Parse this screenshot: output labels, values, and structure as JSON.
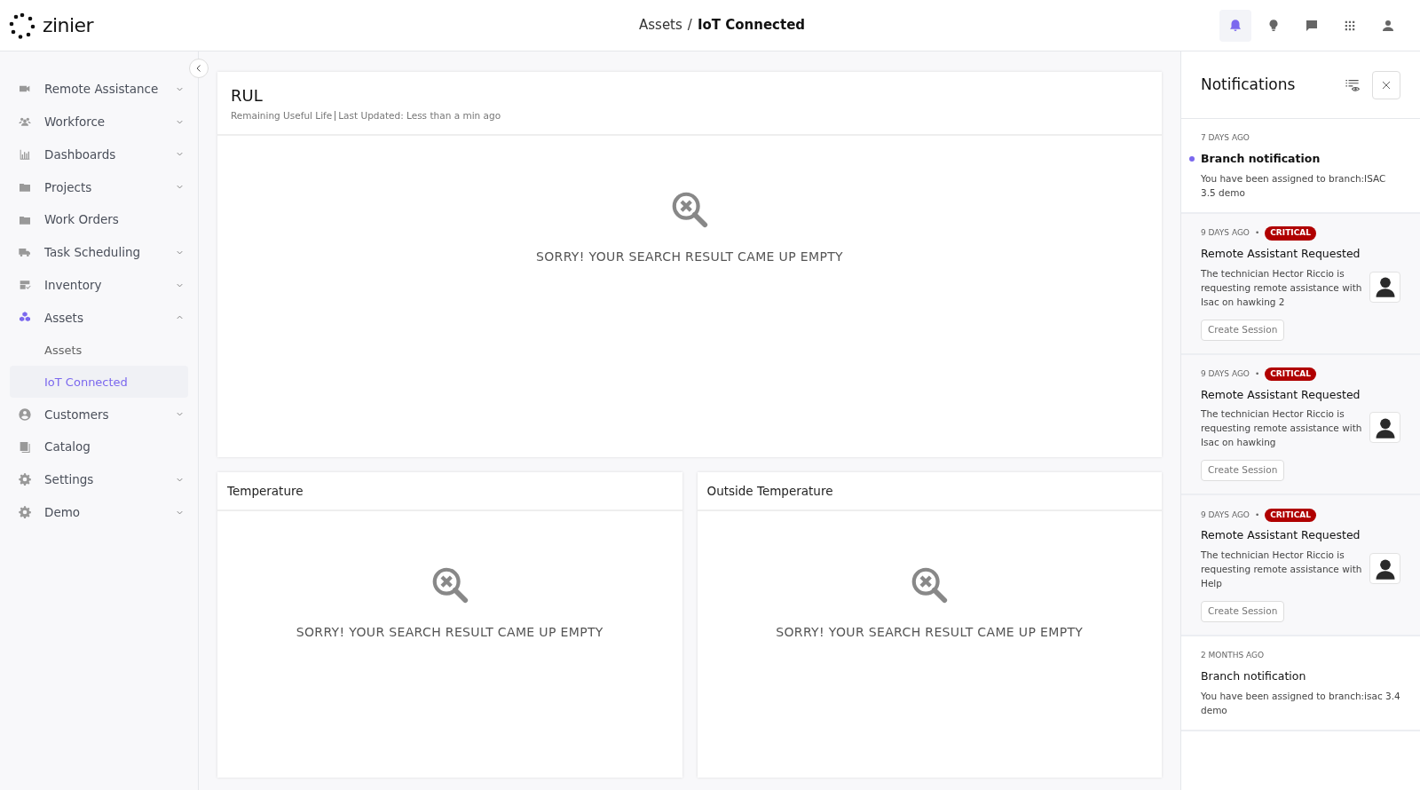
{
  "header": {
    "logo": "zinier",
    "breadcrumb": [
      "Assets",
      "IoT Connected"
    ],
    "breadcrumb_separator": "/",
    "icons": [
      {
        "kind": "bell",
        "selected": true
      },
      {
        "kind": "bulb",
        "selected": false
      },
      {
        "kind": "chat",
        "selected": false
      },
      {
        "kind": "apps",
        "selected": false
      },
      {
        "kind": "user",
        "selected": false
      }
    ]
  },
  "sidebar": {
    "items": [
      {
        "label": "Remote Assistance",
        "kind": "video",
        "expanded": false
      },
      {
        "label": "Workforce",
        "kind": "people",
        "expanded": false
      },
      {
        "label": "Dashboards",
        "kind": "chart",
        "expanded": false
      },
      {
        "label": "Projects",
        "kind": "card",
        "expanded": false
      },
      {
        "label": "Work Orders",
        "kind": "card"
      },
      {
        "label": "Task Scheduling",
        "kind": "truck",
        "expanded": false
      },
      {
        "label": "Inventory",
        "kind": "box",
        "expanded": false
      },
      {
        "label": "Assets",
        "kind": "cubes",
        "expanded": true,
        "children": [
          {
            "label": "Assets",
            "selected": false
          },
          {
            "label": "IoT Connected",
            "selected": true
          }
        ]
      },
      {
        "label": "Customers",
        "kind": "person",
        "expanded": false
      },
      {
        "label": "Catalog",
        "kind": "book"
      },
      {
        "label": "Settings",
        "kind": "gear",
        "expanded": false
      },
      {
        "label": "Demo",
        "kind": "gear",
        "expanded": false
      }
    ]
  },
  "rul_card": {
    "title": "RUL",
    "subtitle": "Remaining Useful Life",
    "updated": "Last Updated: Less than a min ago",
    "empty_message": "SORRY! YOUR SEARCH RESULT CAME UP EMPTY"
  },
  "cards": [
    {
      "title": "Temperature",
      "empty_message": "SORRY! YOUR SEARCH RESULT CAME UP EMPTY"
    },
    {
      "title": "Outside Temperature",
      "empty_message": "SORRY! YOUR SEARCH RESULT CAME UP EMPTY"
    }
  ],
  "notifications": {
    "title": "Notifications",
    "items": [
      {
        "kind": "info",
        "time": "7 DAYS AGO",
        "unread": true,
        "title": "Branch notification",
        "body": "You have been assigned to branch:ISAC 3.5 demo"
      },
      {
        "kind": "alert",
        "time": "9 DAYS AGO",
        "separator": "•",
        "badge": "CRITICAL",
        "unread": false,
        "title": "Remote Assistant Requested",
        "body": "The technician Hector Riccio is requesting remote assistance with Isac on hawking 2",
        "action": "Create Session"
      },
      {
        "kind": "alert",
        "time": "9 DAYS AGO",
        "separator": "•",
        "badge": "CRITICAL",
        "unread": false,
        "title": "Remote Assistant Requested",
        "body": "The technician Hector Riccio is requesting remote assistance with Isac on hawking",
        "action": "Create Session"
      },
      {
        "kind": "alert",
        "time": "9 DAYS AGO",
        "separator": "•",
        "badge": "CRITICAL",
        "unread": false,
        "title": "Remote Assistant Requested",
        "body": "The technician Hector Riccio is requesting remote assistance with Help",
        "action": "Create Session"
      },
      {
        "kind": "info",
        "time": "2 MONTHS AGO",
        "unread": false,
        "title": "Branch notification",
        "body": "You have been assigned to branch:isac 3.4 demo"
      }
    ]
  }
}
